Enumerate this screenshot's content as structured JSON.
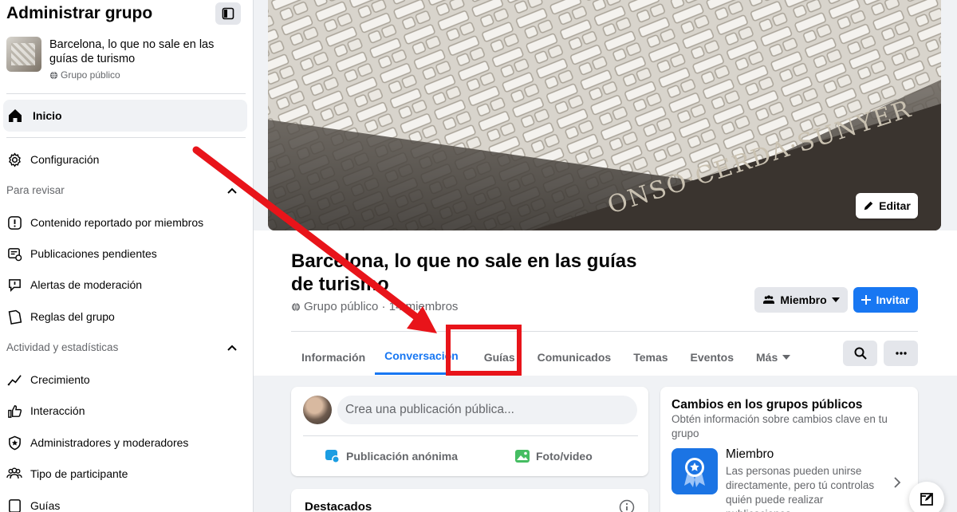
{
  "sidebar": {
    "title": "Administrar grupo",
    "group_name": "Barcelona, lo que no sale en las guías de turismo",
    "group_privacy": "Grupo público",
    "home": "Inicio",
    "settings": "Configuración",
    "section_review": "Para revisar",
    "review_items": [
      {
        "label": "Contenido reportado por miembros",
        "icon": "report-icon"
      },
      {
        "label": "Publicaciones pendientes",
        "icon": "pending-posts-icon"
      },
      {
        "label": "Alertas de moderación",
        "icon": "moderation-alert-icon"
      },
      {
        "label": "Reglas del grupo",
        "icon": "rules-icon"
      }
    ],
    "section_activity": "Actividad y estadísticas",
    "activity_items": [
      {
        "label": "Crecimiento",
        "icon": "growth-icon"
      },
      {
        "label": "Interacción",
        "icon": "thumbs-up-icon"
      },
      {
        "label": "Administradores y moderadores",
        "icon": "shield-star-icon"
      },
      {
        "label": "Tipo de participante",
        "icon": "people-icon"
      },
      {
        "label": "Guías",
        "icon": "guides-icon"
      }
    ]
  },
  "cover": {
    "edit_label": "Editar",
    "inscription": "ONSO·CERDA·SUNYER"
  },
  "group": {
    "title": "Barcelona, lo que no sale en las guías de turismo",
    "meta": "Grupo público · 14  miembros",
    "member_button": "Miembro",
    "invite_button": "Invitar"
  },
  "tabs": [
    {
      "label": "Información"
    },
    {
      "label": "Conversación"
    },
    {
      "label": "Guías"
    },
    {
      "label": "Comunicados"
    },
    {
      "label": "Temas"
    },
    {
      "label": "Eventos"
    },
    {
      "label": "Más"
    }
  ],
  "composer": {
    "placeholder": "Crea una publicación pública...",
    "anonymous": "Publicación anónima",
    "photo": "Foto/video"
  },
  "featured": {
    "title": "Destacados"
  },
  "right_card": {
    "title": "Cambios en los grupos públicos",
    "subtitle": "Obtén información sobre cambios clave en tu grupo",
    "item_title": "Miembro",
    "item_desc": "Las personas pueden unirse directamente, pero tú controlas quién puede realizar publicaciones"
  },
  "colors": {
    "accent": "#1877f2",
    "annotation": "#e8141a"
  }
}
